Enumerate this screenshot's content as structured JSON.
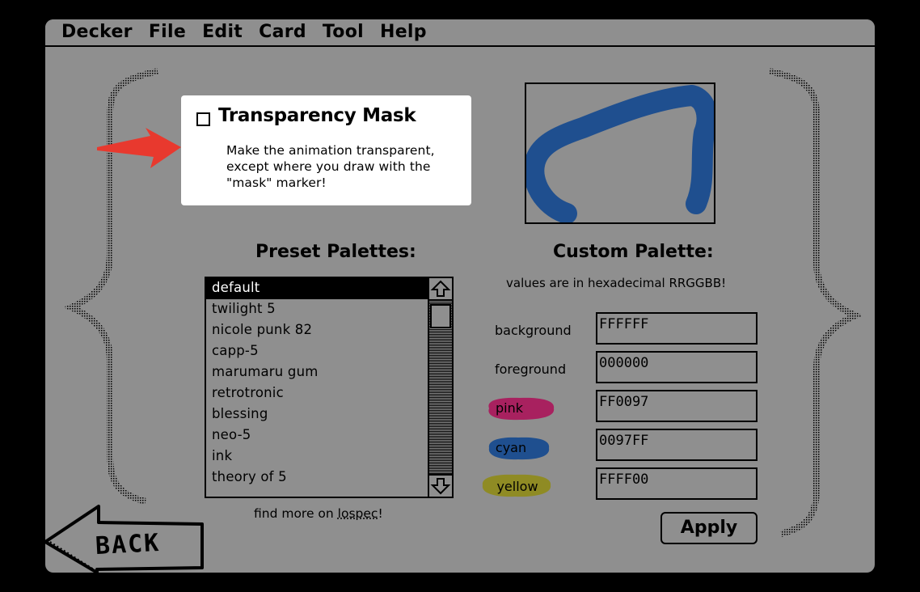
{
  "menubar": {
    "items": [
      "Decker",
      "File",
      "Edit",
      "Card",
      "Tool",
      "Help"
    ]
  },
  "transparency": {
    "title": "Transparency Mask",
    "checked": false,
    "description": "Make the animation transparent, except where you draw with the \"mask\" marker!"
  },
  "preset": {
    "heading": "Preset Palettes:",
    "items": [
      "default",
      "twilight 5",
      "nicole punk 82",
      "capp-5",
      "marumaru gum",
      "retrotronic",
      "blessing",
      "neo-5",
      "ink",
      "theory of 5"
    ],
    "selected_index": 0,
    "footer_prefix": "find more on ",
    "footer_link": "lospec",
    "footer_suffix": "!"
  },
  "custom": {
    "heading": "Custom Palette:",
    "hint": "values are in hexadecimal RRGGBB!",
    "fields": [
      {
        "label": "background",
        "value": "FFFFFF"
      },
      {
        "label": "foreground",
        "value": "000000"
      },
      {
        "label": "pink",
        "value": "FF0097",
        "swatch": "#a8215f"
      },
      {
        "label": "cyan",
        "value": "0097FF",
        "swatch": "#1f4f8f"
      },
      {
        "label": "yellow",
        "value": "FFFF00",
        "swatch": "#8f8b24"
      }
    ],
    "apply_label": "Apply"
  },
  "back": {
    "label": "BACK"
  },
  "colors": {
    "screen_bg": "#8f8f8f",
    "preview_stroke": "#1f4f8f",
    "arrow": "#e8392e"
  }
}
